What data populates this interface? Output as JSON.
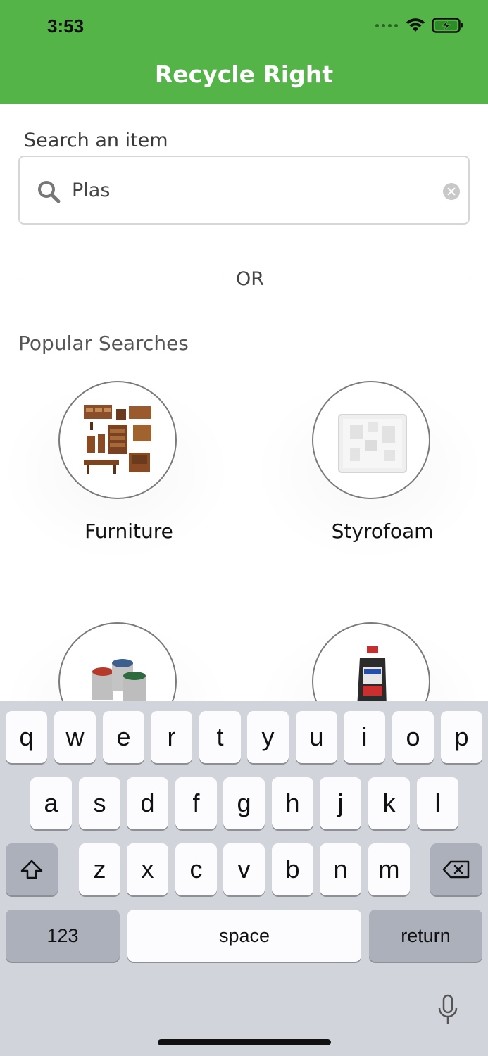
{
  "status": {
    "time": "3:53"
  },
  "header": {
    "title": "Recycle Right",
    "bg_color": "#54b447"
  },
  "search": {
    "label": "Search an item",
    "value": "Plas"
  },
  "divider": {
    "text": "OR"
  },
  "popular": {
    "title": "Popular Searches",
    "items": [
      {
        "label": "Furniture",
        "icon": "furniture-photo"
      },
      {
        "label": "Styrofoam",
        "icon": "styrofoam-photo"
      },
      {
        "label": "",
        "icon": "paint-cans-photo"
      },
      {
        "label": "",
        "icon": "motor-oil-bottle-photo"
      }
    ]
  },
  "keyboard": {
    "row1": [
      "q",
      "w",
      "e",
      "r",
      "t",
      "y",
      "u",
      "i",
      "o",
      "p"
    ],
    "row2": [
      "a",
      "s",
      "d",
      "f",
      "g",
      "h",
      "j",
      "k",
      "l"
    ],
    "row3": [
      "z",
      "x",
      "c",
      "v",
      "b",
      "n",
      "m"
    ],
    "numbers_label": "123",
    "space_label": "space",
    "return_label": "return"
  }
}
